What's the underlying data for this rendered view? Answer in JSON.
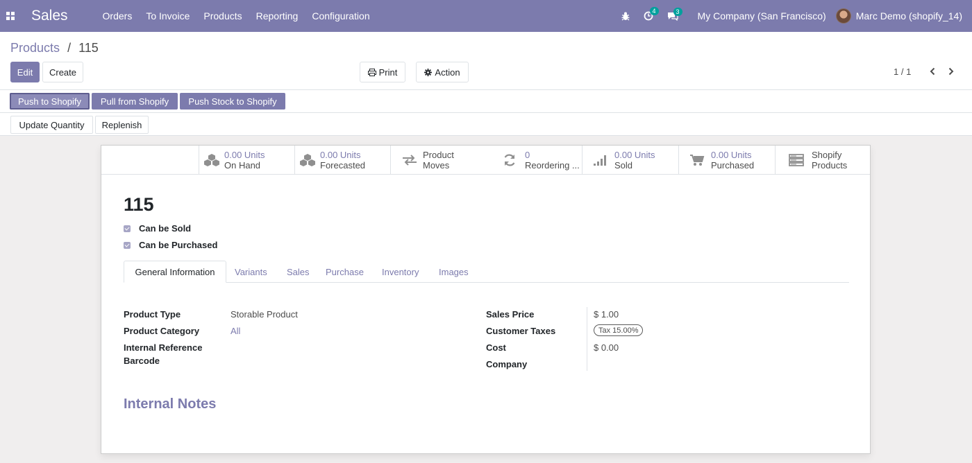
{
  "navbar": {
    "app_name": "Sales",
    "menu": [
      "Orders",
      "To Invoice",
      "Products",
      "Reporting",
      "Configuration"
    ],
    "activity_count": "4",
    "message_count": "3",
    "company": "My Company (San Francisco)",
    "user": "Marc Demo (shopify_14)"
  },
  "breadcrumb": {
    "parent": "Products",
    "separator": "/",
    "current": "115"
  },
  "buttons": {
    "edit": "Edit",
    "create": "Create",
    "print": "Print",
    "action": "Action"
  },
  "pager": {
    "value": "1 / 1"
  },
  "header_buttons": {
    "push_to_shopify": "Push to Shopify",
    "pull_from_shopify": "Pull from Shopify",
    "push_stock": "Push Stock to Shopify",
    "update_quantity": "Update Quantity",
    "replenish": "Replenish"
  },
  "smart_buttons": [
    {
      "value": "0.00 Units",
      "label": "On Hand",
      "icon": "cubes-icon"
    },
    {
      "value": "0.00 Units",
      "label": "Forecasted",
      "icon": "cubes-icon"
    },
    {
      "value": "Product",
      "label": "Moves",
      "icon": "exchange-icon"
    },
    {
      "value": "0",
      "label": "Reordering ...",
      "icon": "refresh-icon"
    },
    {
      "value": "0.00 Units",
      "label": "Sold",
      "icon": "signal-icon"
    },
    {
      "value": "0.00 Units",
      "label": "Purchased",
      "icon": "cart-icon"
    },
    {
      "value": "Shopify",
      "label": "Products",
      "icon": "server-icon"
    }
  ],
  "product": {
    "name": "115",
    "can_be_sold": "Can be Sold",
    "can_be_purchased": "Can be Purchased"
  },
  "tabs": [
    "General Information",
    "Variants",
    "Sales",
    "Purchase",
    "Inventory",
    "Images"
  ],
  "fields": {
    "product_type_label": "Product Type",
    "product_type": "Storable Product",
    "product_category_label": "Product Category",
    "product_category": "All",
    "internal_reference_label": "Internal Reference",
    "barcode_label": "Barcode",
    "sales_price_label": "Sales Price",
    "sales_price": "$ 1.00",
    "customer_taxes_label": "Customer Taxes",
    "customer_taxes": "Tax 15.00%",
    "cost_label": "Cost",
    "cost": "$ 0.00",
    "company_label": "Company"
  },
  "notes_title": "Internal Notes",
  "colors": {
    "brand": "#7c7bad",
    "badge": "#00a09d"
  }
}
